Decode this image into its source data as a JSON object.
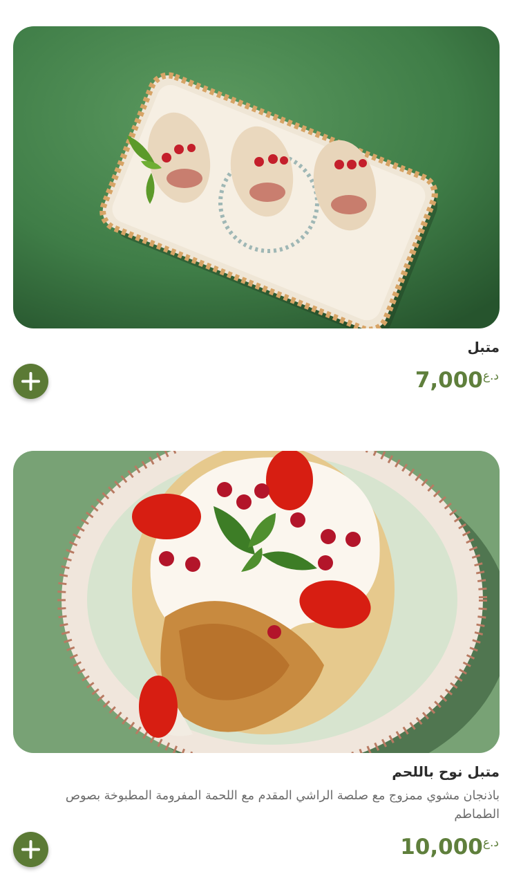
{
  "colors": {
    "accent": "#5b7a35",
    "price": "#5f7f3c",
    "title": "#2b2b2b",
    "description": "#6a6a6a"
  },
  "items": [
    {
      "name": "متبل",
      "description": "",
      "price": "7,000",
      "currency": "د.ع",
      "photo_icon": "food-photo-mutabbal",
      "add_icon": "plus-icon"
    },
    {
      "name": "متبل نوح باللحم",
      "description": "باذنجان مشوي ممزوج مع صلصة الراشي المقدم مع اللحمة المفرومة المطبوخة بصوص الطماطم",
      "price": "10,000",
      "currency": "د.ع",
      "photo_icon": "food-photo-mutabbal-meat",
      "add_icon": "plus-icon"
    }
  ]
}
